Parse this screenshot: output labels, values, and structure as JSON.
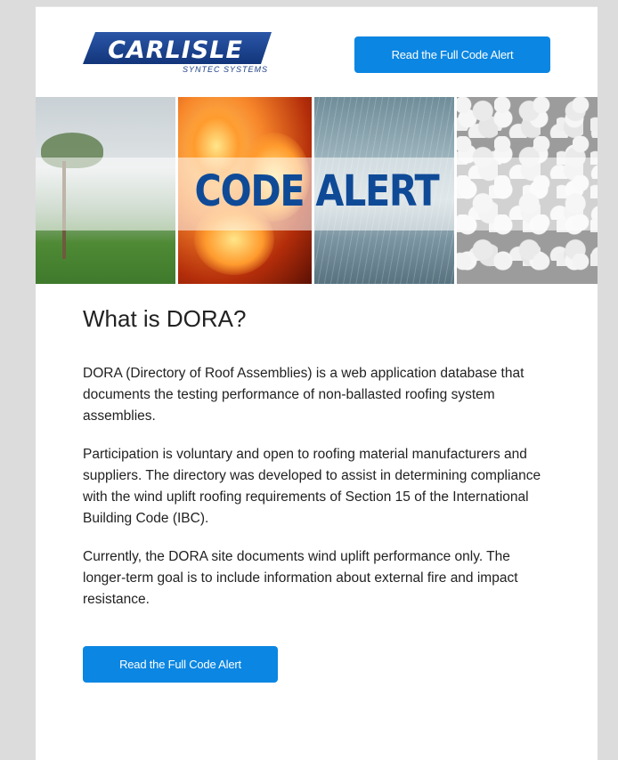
{
  "brand": {
    "name": "CARLISLE",
    "subtitle": "SYNTEC SYSTEMS",
    "color": "#1c3f86"
  },
  "header": {
    "cta_label": "Read the Full Code Alert"
  },
  "hero": {
    "title": "CODE ALERT",
    "panels": [
      "hurricane-palms",
      "fire-flames",
      "rain-water",
      "hail-stones"
    ],
    "title_color": "#0f4a97"
  },
  "article": {
    "heading": "What is DORA?",
    "paragraphs": [
      "DORA (Directory of Roof Assemblies) is a web application database that documents the testing performance of non-ballasted roofing system assemblies.",
      "Participation is voluntary and open to roofing material manufacturers and suppliers. The directory was developed to assist in determining compliance with the wind uplift roofing requirements of Section 15 of the International Building Code (IBC).",
      "Currently, the DORA site documents wind uplift performance only. The longer-term goal is to include information about external fire and impact resistance."
    ],
    "cta_label": "Read the Full Code Alert"
  },
  "colors": {
    "accent": "#0b86e2",
    "background": "#dcdcdc",
    "card": "#ffffff"
  }
}
